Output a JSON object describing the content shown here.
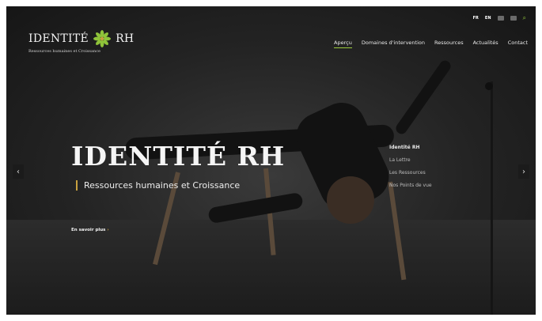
{
  "header": {
    "logo_title_left": "IDENTITÉ",
    "logo_title_right": "RH",
    "logo_sub": "Ressources humaines et Croissance",
    "langs": [
      "FR",
      "EN"
    ],
    "nav": [
      "Aperçu",
      "Domaines d'intervention",
      "Ressources",
      "Actualités",
      "Contact"
    ]
  },
  "hero": {
    "title": "IDENTITÉ RH",
    "subtitle": "Ressources humaines et Croissance",
    "cta": "En savoir plus"
  },
  "submenu": [
    "Identité RH",
    "La Lettre",
    "Les Ressources",
    "Nos Points de vue"
  ],
  "colors": {
    "accent": "#9ccc3c",
    "gold": "#c9a13f"
  },
  "icons": [
    "search-icon",
    "chevron-left-icon",
    "chevron-right-icon",
    "flower-logo-icon"
  ]
}
